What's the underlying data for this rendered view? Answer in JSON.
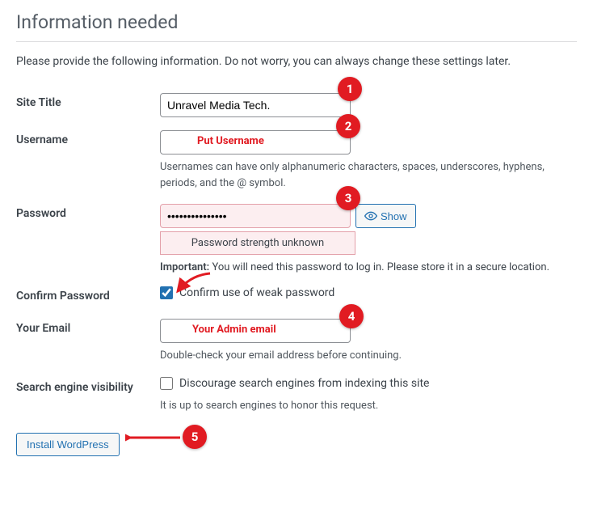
{
  "page": {
    "title": "Information needed",
    "intro": "Please provide the following information. Do not worry, you can always change these settings later."
  },
  "fields": {
    "site_title": {
      "label": "Site Title",
      "value": "Unravel Media Tech."
    },
    "username": {
      "label": "Username",
      "value": "",
      "hint": "Usernames can have only alphanumeric characters, spaces, underscores, hyphens, periods, and the @ symbol."
    },
    "password": {
      "label": "Password",
      "value": "•••••••••••••••",
      "show_button": "Show",
      "strength": "Password strength unknown",
      "important_label": "Important:",
      "important_text": " You will need this password to log in. Please store it in a secure location."
    },
    "confirm_pw": {
      "label": "Confirm Password",
      "checkbox_label": "Confirm use of weak password",
      "checked": true
    },
    "email": {
      "label": "Your Email",
      "value": "",
      "hint": "Double-check your email address before continuing."
    },
    "sev": {
      "label": "Search engine visibility",
      "checkbox_label": "Discourage search engines from indexing this site",
      "checked": false,
      "hint": "It is up to search engines to honor this request."
    }
  },
  "actions": {
    "install": "Install WordPress"
  },
  "annotations": {
    "b1": "1",
    "b2": "2",
    "b3": "3",
    "b4": "4",
    "b5": "5",
    "t_username": "Put Username",
    "t_email": "Your Admin email"
  }
}
